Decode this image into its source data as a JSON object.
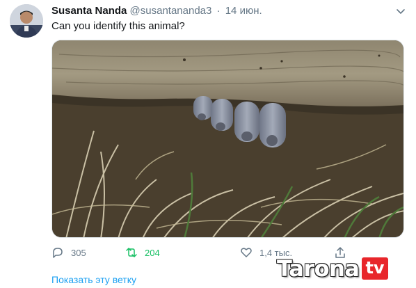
{
  "tweet": {
    "author_name": "Susanta Nanda",
    "author_handle": "@susantananda3",
    "separator": "·",
    "date": "14 июн.",
    "text": "Can you identify this animal?"
  },
  "actions": {
    "replies": "305",
    "retweets": "204",
    "likes": "1,4 тыс."
  },
  "show_thread": "Показать эту ветку",
  "watermark": {
    "text": "Tarona",
    "suffix": "tv"
  },
  "colors": {
    "link": "#1da1f2",
    "muted": "#657786",
    "retweet": "#17bf63",
    "watermark_badge": "#e8262b"
  },
  "icons": [
    "user-avatar",
    "chevron-down-icon",
    "reply-icon",
    "retweet-icon",
    "like-icon",
    "share-icon"
  ]
}
